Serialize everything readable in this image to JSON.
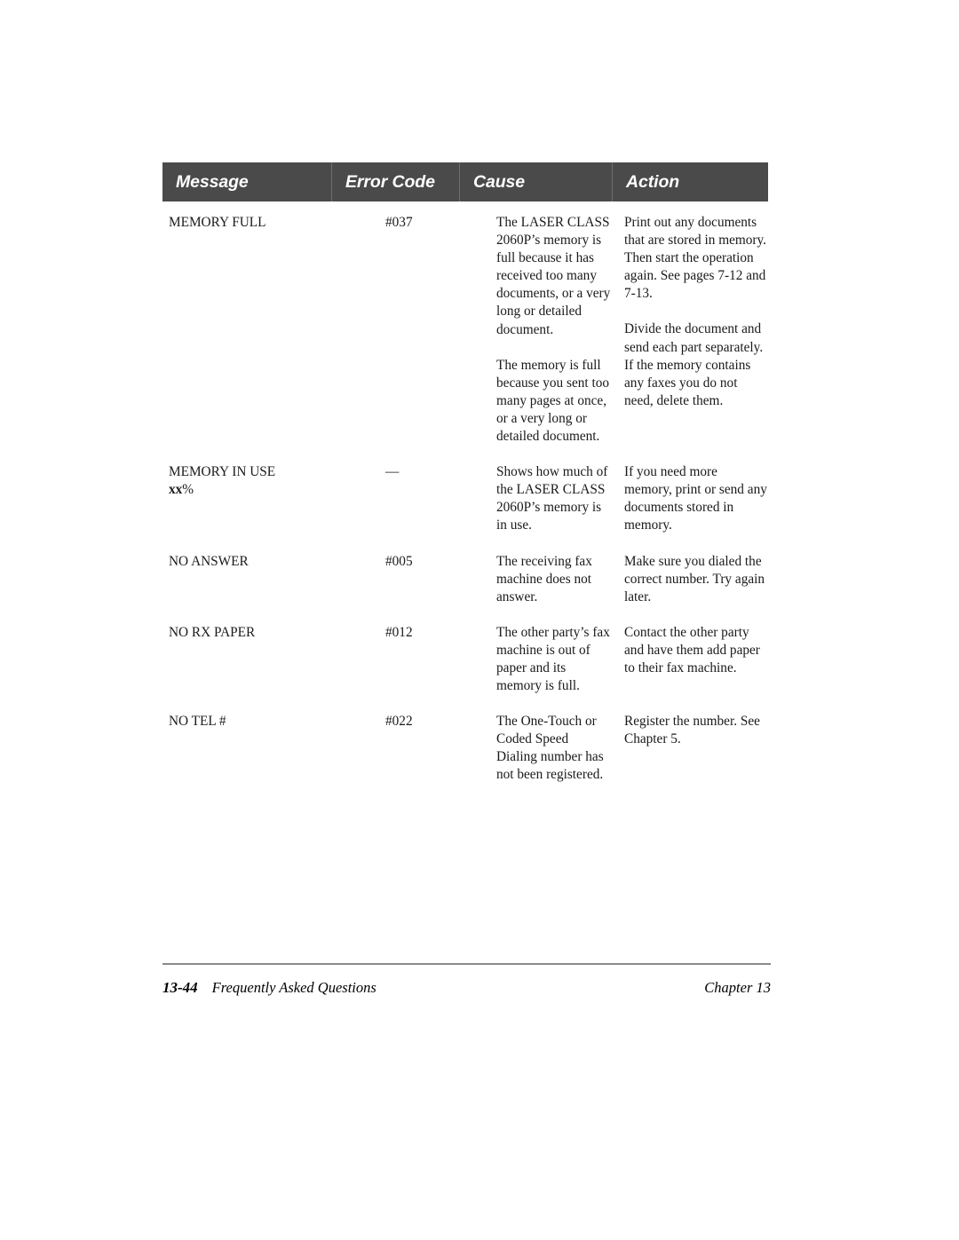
{
  "table": {
    "columns": [
      {
        "key": "message",
        "label": "Message"
      },
      {
        "key": "errorcode",
        "label": "Error Code"
      },
      {
        "key": "cause",
        "label": "Cause"
      },
      {
        "key": "action",
        "label": "Action"
      }
    ],
    "header_bg": "#4a4a4a",
    "header_text_color": "#ffffff",
    "rows": [
      {
        "message": "MEMORY FULL",
        "message_sub": "",
        "errorcode": "#037",
        "blocks": [
          {
            "cause": "The LASER CLASS 2060P’s memory is full because it has received too many documents, or a very long or detailed document.",
            "action": "Print out any documents that are stored in memory. Then start the operation again. See pages 7-12 and 7-13."
          },
          {
            "cause": "The memory is full because you sent too many pages at once, or a very long or detailed document.",
            "action": "Divide the document and send each part separately. If the memory contains any faxes you do not need, delete them."
          }
        ]
      },
      {
        "message": "MEMORY IN USE",
        "message_sub_bold": "xx",
        "message_sub_rest": "%",
        "errorcode": "—",
        "blocks": [
          {
            "cause": "Shows how much of the LASER CLASS 2060P’s memory is in use.",
            "action": "If you need more memory, print or send any documents stored in memory."
          }
        ]
      },
      {
        "message": "NO ANSWER",
        "message_sub": "",
        "errorcode": "#005",
        "blocks": [
          {
            "cause": "The receiving fax machine does not answer.",
            "action": "Make sure you dialed the correct number. Try again later."
          }
        ]
      },
      {
        "message": "NO RX PAPER",
        "message_sub": "",
        "errorcode": "#012",
        "blocks": [
          {
            "cause": "The other party’s fax machine is out of paper and its memory is full.",
            "action": "Contact the other party and have them add paper to their fax machine."
          }
        ]
      },
      {
        "message": "NO TEL #",
        "message_sub": "",
        "errorcode": "#022",
        "blocks": [
          {
            "cause": "The One-Touch or Coded Speed Dialing number has not been registered.",
            "action": "Register the number. See Chapter 5."
          }
        ]
      }
    ]
  },
  "footer": {
    "page_number": "13-44",
    "section_title": "Frequently Asked Questions",
    "chapter": "Chapter 13"
  }
}
